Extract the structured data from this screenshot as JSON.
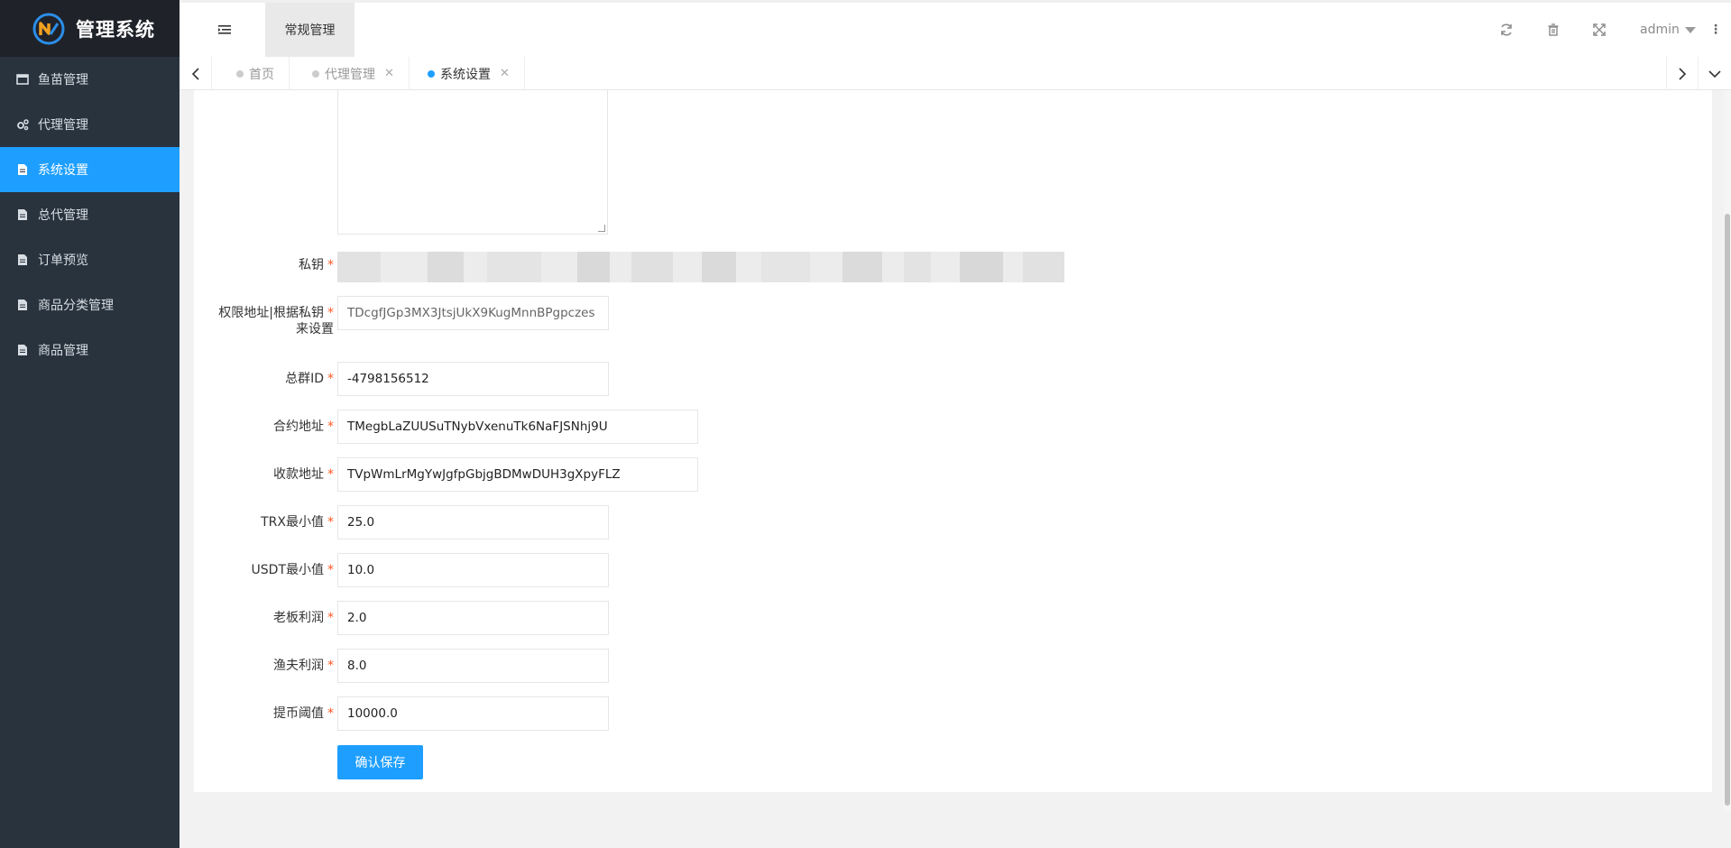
{
  "app": {
    "title": "管理系统"
  },
  "sidebar": {
    "items": [
      {
        "label": "鱼苗管理",
        "icon": "window-icon"
      },
      {
        "label": "代理管理",
        "icon": "gears-icon"
      },
      {
        "label": "系统设置",
        "icon": "document-icon"
      },
      {
        "label": "总代管理",
        "icon": "document-icon"
      },
      {
        "label": "订单预览",
        "icon": "document-icon"
      },
      {
        "label": "商品分类管理",
        "icon": "document-icon"
      },
      {
        "label": "商品管理",
        "icon": "document-icon"
      }
    ],
    "active_index": 2
  },
  "header": {
    "top_tab": "常规管理",
    "user": "admin",
    "icons": [
      "refresh-icon",
      "trash-icon",
      "fullscreen-icon",
      "more-icon"
    ]
  },
  "tabs": [
    {
      "label": "首页",
      "closable": false
    },
    {
      "label": "代理管理",
      "closable": true
    },
    {
      "label": "系统设置",
      "closable": true,
      "active": true
    }
  ],
  "form": {
    "private_key": {
      "label": "私钥",
      "value": ""
    },
    "auth_address": {
      "label_line1": "权限地址|根据私钥",
      "label_line2": "来设置",
      "value": "TDcgfJGp3MX3JtsjUkX9KugMnnBPgpczes"
    },
    "group_id": {
      "label": "总群ID",
      "value": "-4798156512"
    },
    "contract_address": {
      "label": "合约地址",
      "value": "TMegbLaZUUSuTNybVxenuTk6NaFJSNhj9U"
    },
    "receive_address": {
      "label": "收款地址",
      "value": "TVpWmLrMgYwJgfpGbjgBDMwDUH3gXpyFLZ"
    },
    "trx_min": {
      "label": "TRX最小值",
      "value": "25.0"
    },
    "usdt_min": {
      "label": "USDT最小值",
      "value": "10.0"
    },
    "boss_profit": {
      "label": "老板利润",
      "value": "2.0"
    },
    "fisher_profit": {
      "label": "渔夫利润",
      "value": "8.0"
    },
    "withdraw_threshold": {
      "label": "提币阈值",
      "value": "10000.0"
    },
    "required_mark": "*",
    "submit_label": "确认保存"
  },
  "colors": {
    "accent": "#1e9fff",
    "sidebar": "#28333e",
    "required": "#ff5722"
  }
}
